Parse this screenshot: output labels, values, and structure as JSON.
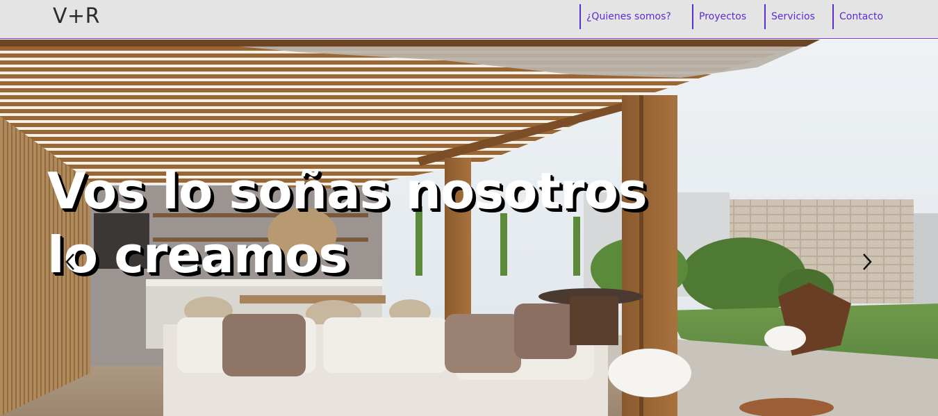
{
  "nav": {
    "brand": "V+R",
    "links": [
      {
        "label": "¿Quienes somos?"
      },
      {
        "label": "Proyectos"
      },
      {
        "label": "Servicios"
      },
      {
        "label": "Contacto"
      }
    ]
  },
  "hero": {
    "headline": "Vos lo soñas nosotros lo creamos",
    "image_description": "outdoor pergola with wooden slats, sofas and garden",
    "controls": {
      "prev_icon": "chevron-left-icon",
      "next_icon": "chevron-right-icon"
    }
  },
  "colors": {
    "nav_bg": "#e4e4e4",
    "accent": "#5b2bd6",
    "headline_text": "#ffffff",
    "headline_shadow": "#000000"
  }
}
